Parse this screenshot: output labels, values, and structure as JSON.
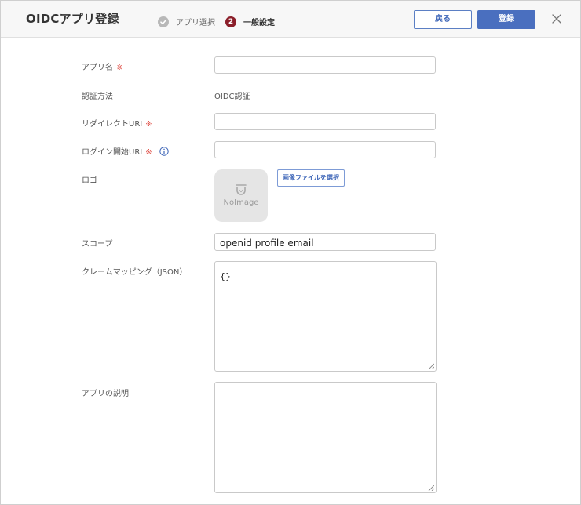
{
  "header": {
    "title": "OIDCアプリ登録",
    "steps": [
      {
        "label": "アプリ選択",
        "state": "done"
      },
      {
        "label": "一般設定",
        "state": "current",
        "number": "2"
      }
    ],
    "back_label": "戻る",
    "register_label": "登録"
  },
  "form": {
    "app_name": {
      "label": "アプリ名",
      "required_mark": "※",
      "value": ""
    },
    "auth_method": {
      "label": "認証方法",
      "value": "OIDC認証"
    },
    "redirect_uri": {
      "label": "リダイレクトURI",
      "required_mark": "※",
      "value": ""
    },
    "login_uri": {
      "label": "ログイン開始URI",
      "required_mark": "※",
      "value": ""
    },
    "logo": {
      "label": "ロゴ",
      "placeholder_text": "NoImage",
      "select_button": "画像ファイルを選択"
    },
    "scope": {
      "label": "スコープ",
      "value": "openid profile email"
    },
    "claim_mapping": {
      "label": "クレームマッピング（JSON）",
      "value": "{}"
    },
    "description": {
      "label": "アプリの説明",
      "value": ""
    }
  },
  "colors": {
    "primary": "#4a6fbf",
    "step_current": "#8b1f2a",
    "required": "#e0534b"
  }
}
